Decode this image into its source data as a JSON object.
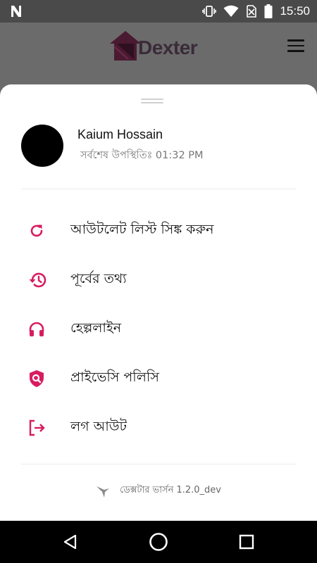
{
  "status_bar": {
    "time": "15:50",
    "icons": [
      "n-notification-icon",
      "vibrate-icon",
      "wifi-icon",
      "no-sim-icon",
      "battery-icon"
    ]
  },
  "app_bar": {
    "brand": "Dexter",
    "menu_icon": "hamburger-icon"
  },
  "profile": {
    "name": "Kaium Hossain",
    "last_seen": "সর্বশেষ উপস্থিতিঃ 01:32 PM"
  },
  "menu": {
    "items": [
      {
        "label": "আউটলেট লিস্ট সিঙ্ক করুন",
        "icon": "refresh-icon"
      },
      {
        "label": "পূর্বের তথ্য",
        "icon": "history-icon"
      },
      {
        "label": "হেল্পলাইন",
        "icon": "headset-icon"
      },
      {
        "label": "প্রাইভেসি পলিসি",
        "icon": "shield-search-icon"
      },
      {
        "label": "লগ আউট",
        "icon": "logout-icon"
      }
    ]
  },
  "footer": {
    "version": "ডেক্সটার ভার্সন 1.2.0_dev",
    "icon": "dexter-bird-icon"
  },
  "colors": {
    "accent": "#d81b60",
    "brand_dark": "#3a2b39",
    "scrim": "#6b6b6b"
  }
}
